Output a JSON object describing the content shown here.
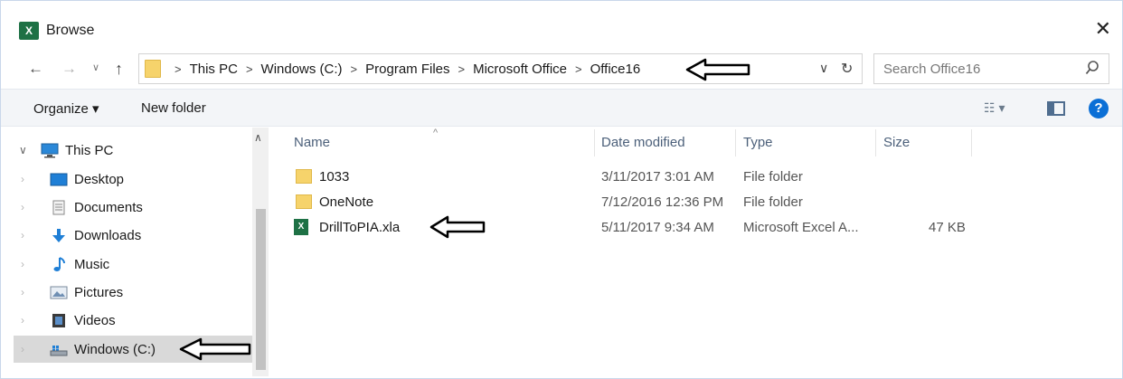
{
  "window": {
    "title": "Browse",
    "app_icon_letter": "X"
  },
  "nav": {
    "back": "←",
    "forward": "→",
    "recent": "∨",
    "up": "↑",
    "breadcrumbs": [
      "This PC",
      "Windows (C:)",
      "Program Files",
      "Microsoft Office",
      "Office16"
    ],
    "separator": ">",
    "dropdown": "∨",
    "refresh": "↻"
  },
  "search": {
    "placeholder": "Search Office16"
  },
  "toolbar": {
    "organize": "Organize ▾",
    "new_folder": "New folder",
    "views": "☷ ▾",
    "help": "?"
  },
  "sidebar": {
    "items": [
      {
        "label": "This PC",
        "icon": "monitor-icon"
      },
      {
        "label": "Desktop",
        "icon": "desktop-icon"
      },
      {
        "label": "Documents",
        "icon": "documents-icon"
      },
      {
        "label": "Downloads",
        "icon": "downloads-icon"
      },
      {
        "label": "Music",
        "icon": "music-icon"
      },
      {
        "label": "Pictures",
        "icon": "pictures-icon"
      },
      {
        "label": "Videos",
        "icon": "videos-icon"
      },
      {
        "label": "Windows (C:)",
        "icon": "drive-icon"
      }
    ],
    "selected": "Windows (C:)"
  },
  "files": {
    "columns": [
      "Name",
      "Date modified",
      "Type",
      "Size"
    ],
    "rows": [
      {
        "name": "1033",
        "date": "3/11/2017 3:01 AM",
        "type": "File folder",
        "size": "",
        "icon": "folder-icon"
      },
      {
        "name": "OneNote",
        "date": "7/12/2016 12:36 PM",
        "type": "File folder",
        "size": "",
        "icon": "folder-icon"
      },
      {
        "name": "DrillToPIA.xla",
        "date": "5/11/2017 9:34 AM",
        "type": "Microsoft Excel A...",
        "size": "47 KB",
        "icon": "excel-file-icon"
      }
    ]
  },
  "colors": {
    "accent": "#0b6fd6",
    "excel_green": "#1e7145",
    "folder": "#f6d36b",
    "header_text": "#4c607a",
    "selection": "#d9d9d9"
  }
}
